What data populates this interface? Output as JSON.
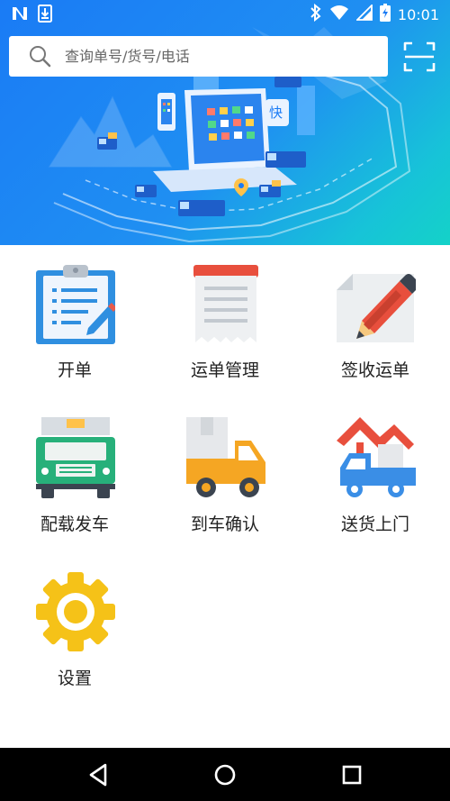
{
  "status_bar": {
    "time": "10:01",
    "icons": [
      "n-app-icon",
      "download-icon",
      "bluetooth-icon",
      "wifi-icon",
      "signal-icon",
      "battery-charging-icon"
    ]
  },
  "search": {
    "placeholder": "查询单号/货号/电话",
    "icon": "search-icon",
    "scan_icon": "scan-icon"
  },
  "banner": {
    "badge_text": "快"
  },
  "menu": [
    {
      "id": "open-order",
      "label": "开单",
      "icon": "clipboard-icon"
    },
    {
      "id": "waybill-management",
      "label": "运单管理",
      "icon": "receipt-icon"
    },
    {
      "id": "sign-waybill",
      "label": "签收运单",
      "icon": "pencil-paper-icon"
    },
    {
      "id": "load-dispatch",
      "label": "配载发车",
      "icon": "truck-front-icon"
    },
    {
      "id": "arrival-confirm",
      "label": "到车确认",
      "icon": "delivery-truck-icon"
    },
    {
      "id": "deliver-home",
      "label": "送货上门",
      "icon": "home-truck-icon"
    },
    {
      "id": "settings",
      "label": "设置",
      "icon": "gear-icon"
    }
  ],
  "colors": {
    "banner_start": "#1a7bf5",
    "banner_end": "#14d2c8",
    "label_text": "#222222"
  },
  "nav": [
    "back-icon",
    "home-icon",
    "recents-icon"
  ]
}
